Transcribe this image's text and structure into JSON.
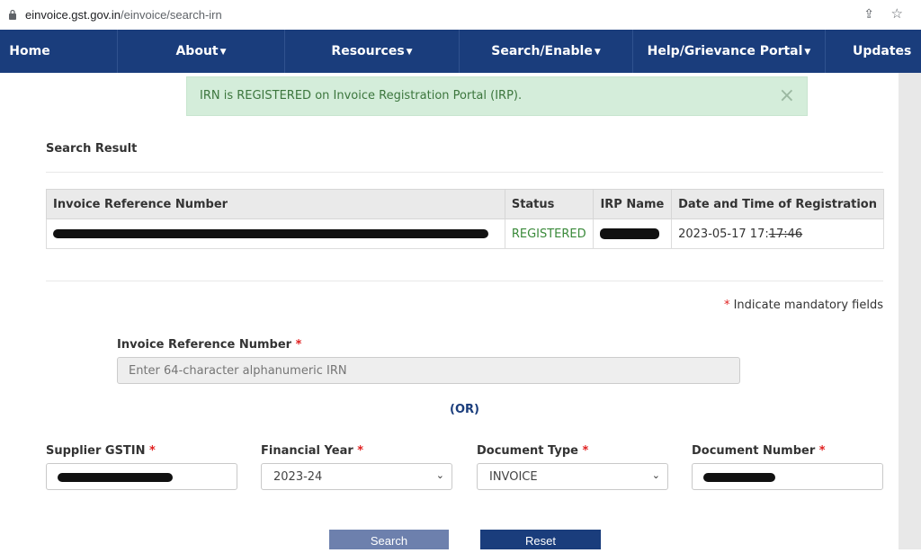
{
  "browser": {
    "url_host": "einvoice.gst.gov.in",
    "url_path": "/einvoice/search-irn"
  },
  "nav": {
    "items": [
      {
        "label": "Home"
      },
      {
        "label": "About"
      },
      {
        "label": "Resources"
      },
      {
        "label": "Search/Enable"
      },
      {
        "label": "Help/Grievance Portal"
      },
      {
        "label": "Updates"
      }
    ]
  },
  "alert": {
    "message": "IRN is REGISTERED on Invoice Registration Portal (IRP).",
    "close": "×"
  },
  "result": {
    "title": "Search Result",
    "columns": [
      "Invoice Reference Number",
      "Status",
      "IRP Name",
      "Date and Time of Registration"
    ],
    "row": {
      "status": "REGISTERED",
      "datetime_prefix": "2023-05-17 17:",
      "datetime_struck": "17:46"
    }
  },
  "form": {
    "mandatory_note": "Indicate mandatory fields",
    "required_mark": "*",
    "irn_label": "Invoice Reference Number",
    "irn_placeholder": "Enter 64-character alphanumeric IRN",
    "or_text": "(OR)",
    "supplier_gstin_label": "Supplier GSTIN",
    "financial_year_label": "Financial Year",
    "financial_year_value": "2023-24",
    "document_type_label": "Document Type",
    "document_type_value": "INVOICE",
    "document_number_label": "Document Number",
    "search_button": "Search",
    "reset_button": "Reset"
  },
  "colors": {
    "nav_bg": "#1a3d7c",
    "alert_bg": "#d4edda",
    "status_green": "#3a8a3a",
    "required_red": "#e02020"
  }
}
